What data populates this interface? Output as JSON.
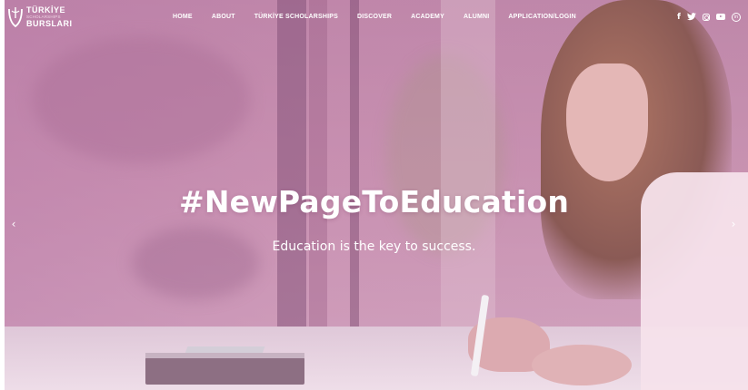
{
  "brand": {
    "line1": "TÜRKİYE",
    "line2": "SCHOLARSHIPS",
    "line3": "BURSLARI"
  },
  "nav": {
    "items": [
      {
        "label": "HOME"
      },
      {
        "label": "ABOUT"
      },
      {
        "label": "TÜRKİYE SCHOLARSHIPS"
      },
      {
        "label": "DISCOVER"
      },
      {
        "label": "ACADEMY"
      },
      {
        "label": "ALUMNI"
      },
      {
        "label": "APPLICATION/LOGIN"
      }
    ]
  },
  "social": {
    "facebook_glyph": "f",
    "twitter_glyph": "🐦",
    "linkedin_glyph": "in"
  },
  "hero": {
    "title": "#NewPageToEducation",
    "subtitle": "Education is the key to success.",
    "prev_glyph": "‹",
    "next_glyph": "›"
  },
  "colors": {
    "overlay": "#c08ab0",
    "text": "#ffffff"
  },
  "icons": [
    "logo-icon",
    "facebook-icon",
    "twitter-icon",
    "instagram-icon",
    "youtube-icon",
    "linkedin-icon",
    "chevron-left-icon",
    "chevron-right-icon"
  ]
}
